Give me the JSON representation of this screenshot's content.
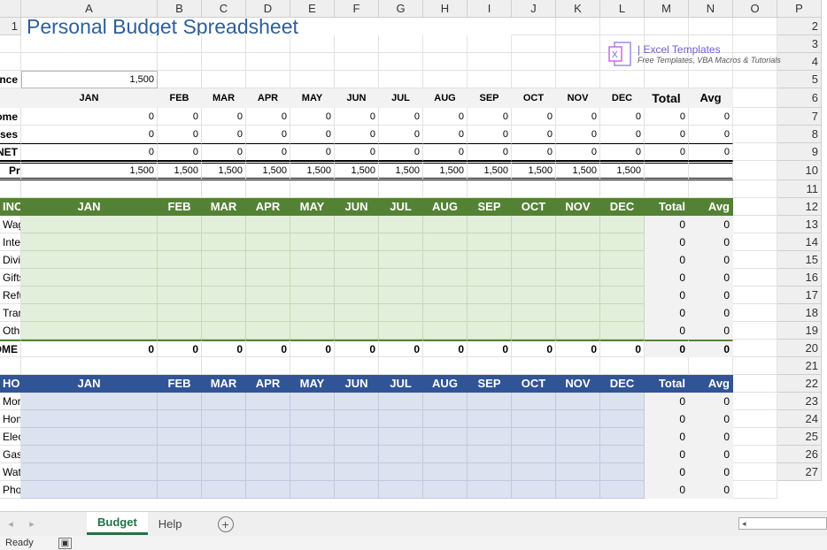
{
  "columns": [
    "A",
    "B",
    "C",
    "D",
    "E",
    "F",
    "G",
    "H",
    "I",
    "J",
    "K",
    "L",
    "M",
    "N",
    "O",
    "P"
  ],
  "title": "Personal Budget Spreadsheet",
  "logo": {
    "line1": "| Excel Templates",
    "line2": "Free Templates, VBA Macros & Tutorials"
  },
  "starting_balance": {
    "label": "Starting Balance",
    "value": "1,500"
  },
  "months_upper": [
    "JAN",
    "FEB",
    "MAR",
    "APR",
    "MAY",
    "JUN",
    "JUL",
    "AUG",
    "SEP",
    "OCT",
    "NOV",
    "DEC"
  ],
  "summary": {
    "total_label": "Total",
    "avg_label": "Avg",
    "income_label": "Total Income",
    "expenses_label": "Total Expenses",
    "net_label": "NET",
    "projected_label": "Projected End Balance",
    "zero": "0",
    "balance": "1,500"
  },
  "income": {
    "header": "INCOME",
    "items": [
      "Wages & Tips",
      "Interest Income",
      "Dividends",
      "Gifts Received",
      "Refunds/Reimbursements",
      "Transfer From Savings",
      "Other"
    ],
    "total_label": "Total INCOME"
  },
  "home": {
    "header": "HOME EXPENSES",
    "items": [
      "Mortgage/Rent",
      "Home/Rental Insurance",
      "Electricity",
      "Gas/Oil",
      "Water/Sewer/Trash",
      "Phone"
    ]
  },
  "tabs": [
    "Budget",
    "Help"
  ],
  "status": "Ready"
}
